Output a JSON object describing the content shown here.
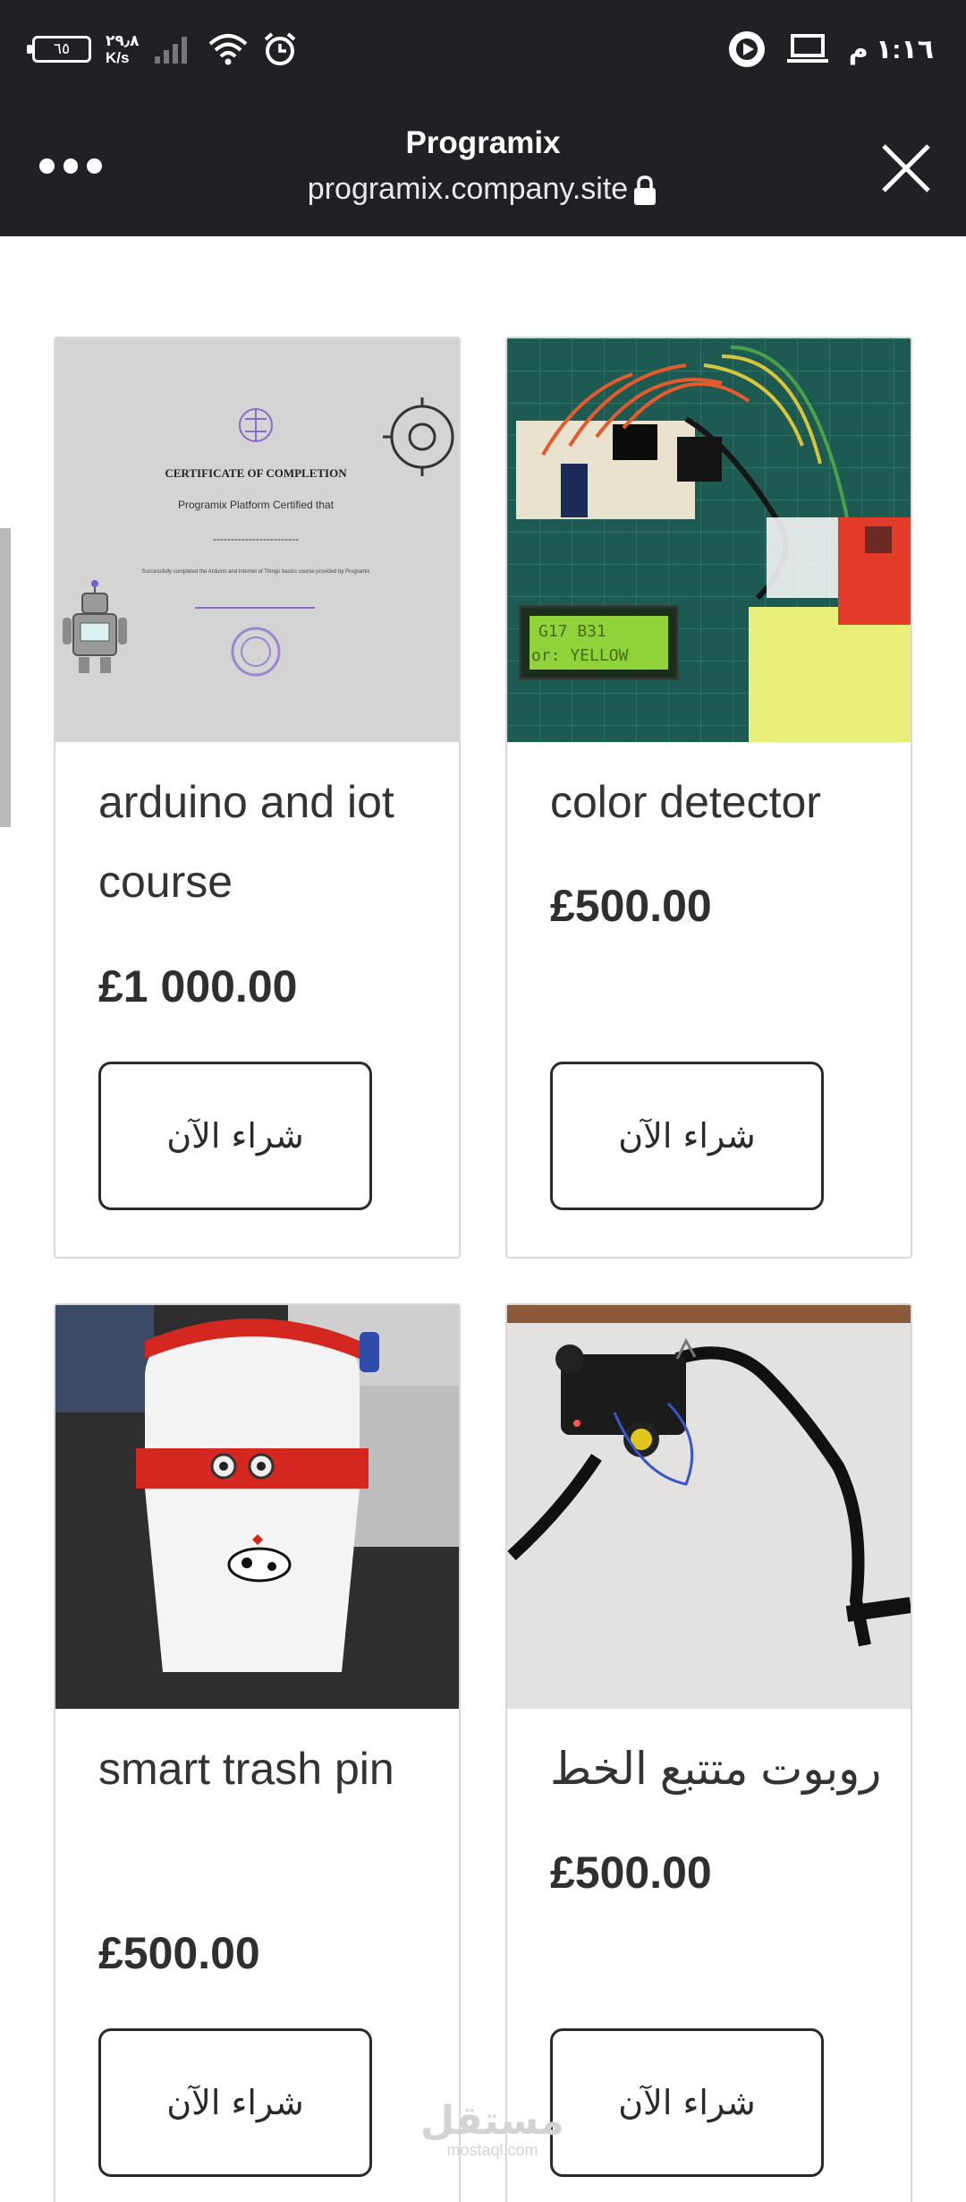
{
  "status_bar": {
    "battery": "٦٥",
    "net_speed_value": "٢٩٫٨",
    "net_speed_unit": "K/s",
    "time": "١:١٦ م",
    "icons": [
      "battery-icon",
      "signal-icon",
      "wifi-icon",
      "alarm-icon",
      "play-icon",
      "laptop-icon"
    ]
  },
  "browser": {
    "title": "Programix",
    "url": "programix.company.site",
    "icons": [
      "menu-dots-icon",
      "lock-icon",
      "close-icon"
    ]
  },
  "products": [
    {
      "name": "arduino and iot course",
      "price": "£1 000.00",
      "button": "شراء الآن",
      "image": "certificate-image"
    },
    {
      "name": "color detector",
      "price": "£500.00",
      "button": "شراء الآن",
      "image": "circuit-image"
    },
    {
      "name": "smart trash pin",
      "price": "£500.00",
      "button": "شراء الآن",
      "image": "trash-bin-image"
    },
    {
      "name": "روبوت متتبع الخط",
      "price": "£500.00",
      "button": "شراء الآن",
      "image": "line-robot-image"
    }
  ],
  "certificate": {
    "title": "CERTIFICATE OF COMPLETION",
    "subtitle": "Programix Platform Certified that",
    "dashes": "------------------------",
    "body": "Successfully completed the Arduino and Internet of Things basics course provided by Programix"
  },
  "lcd": {
    "line1": "G17   B31",
    "line2": "or: YELLOW"
  },
  "watermark": {
    "arabic": "مستقل",
    "latin": "mostaql.com"
  }
}
